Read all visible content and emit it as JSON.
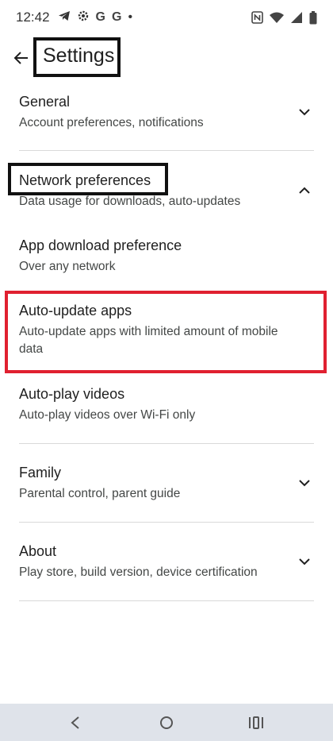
{
  "status_bar": {
    "time": "12:42",
    "left_icons": [
      "telegram-icon",
      "settings-gear-icon",
      "google-icon",
      "google-icon",
      "dot-icon"
    ],
    "g1": "G",
    "g2": "G",
    "dot": "•",
    "right_icons": [
      "nfc-icon",
      "wifi-icon",
      "signal-icon",
      "battery-icon"
    ]
  },
  "app_bar": {
    "title": "Settings",
    "back_icon": "arrow-back-icon"
  },
  "sections": {
    "general": {
      "label": "General",
      "sub": "Account preferences, notifications",
      "expanded": false
    },
    "network": {
      "label": "Network preferences",
      "sub": "Data usage for downloads, auto-updates",
      "expanded": true,
      "items": [
        {
          "label": "App download preference",
          "sub": "Over any network"
        },
        {
          "label": "Auto-update apps",
          "sub": "Auto-update apps with limited amount of mobile data"
        },
        {
          "label": "Auto-play videos",
          "sub": "Auto-play videos over Wi-Fi only"
        }
      ]
    },
    "family": {
      "label": "Family",
      "sub": "Parental control, parent guide",
      "expanded": false
    },
    "about": {
      "label": "About",
      "sub": "Play store, build version, device certification",
      "expanded": false
    }
  },
  "annotations": {
    "title_box_color": "#111111",
    "network_box_color": "#111111",
    "highlight_color": "#e02030"
  },
  "nav_bar": {
    "buttons": [
      "back-nav-icon",
      "home-nav-icon",
      "recents-nav-icon"
    ]
  }
}
